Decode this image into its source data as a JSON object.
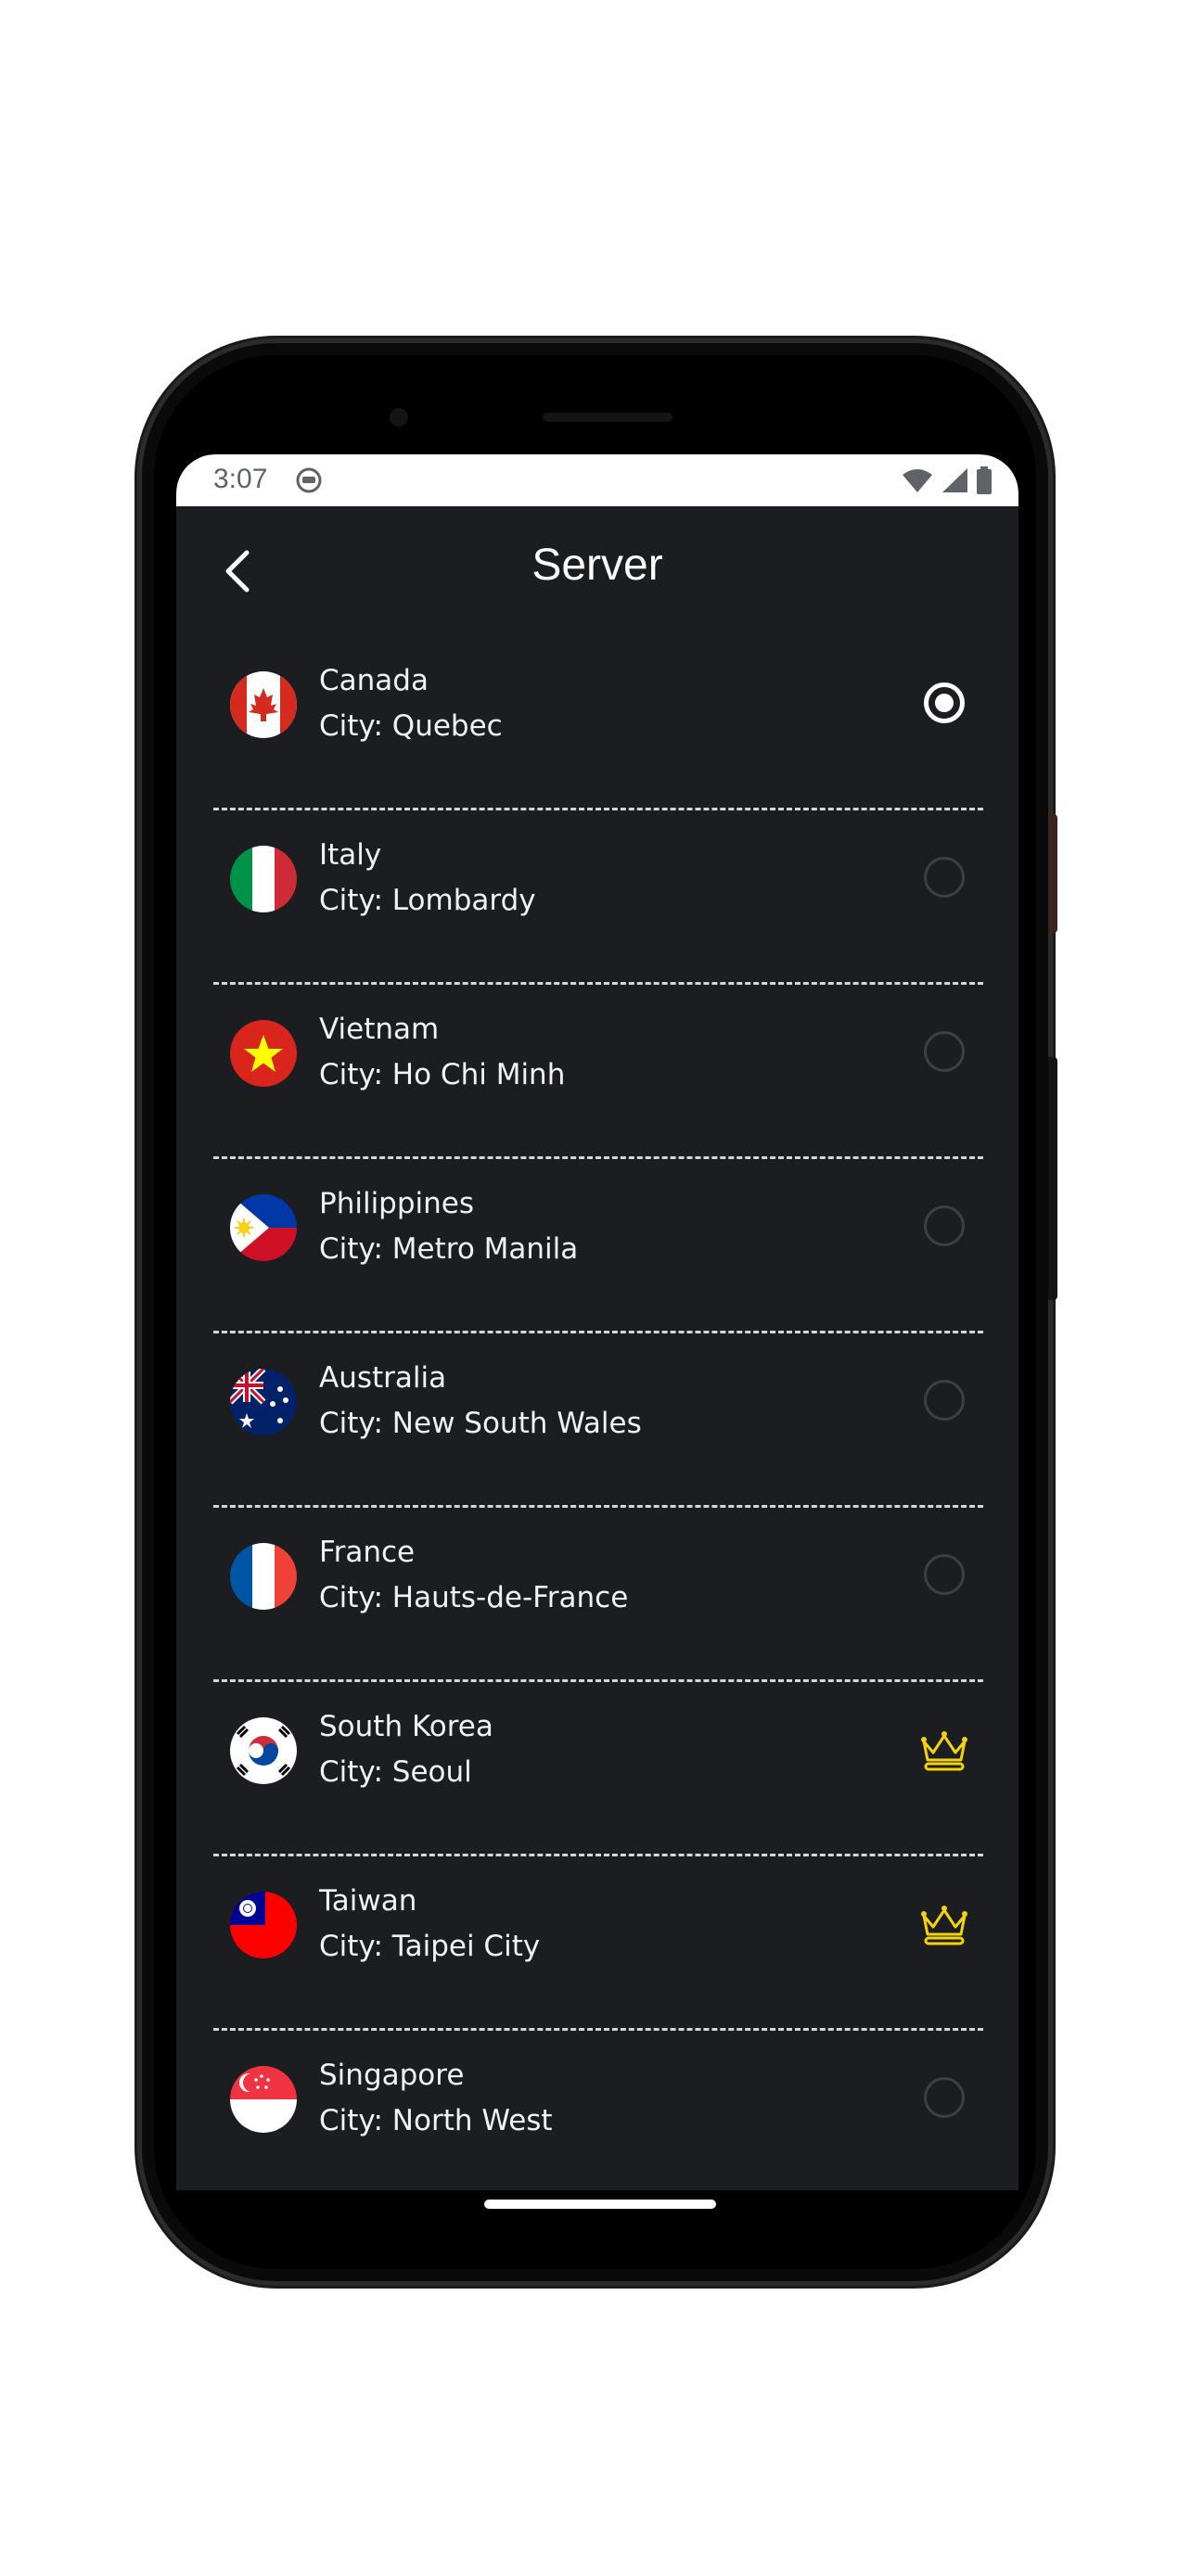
{
  "status_bar": {
    "time": "3:07"
  },
  "header": {
    "title": "Server"
  },
  "colors": {
    "background": "#1c1d21",
    "accent_premium": "#f4d30b",
    "divider": "#d6d6d6"
  },
  "servers": [
    {
      "country": "Canada",
      "city": "City: Quebec",
      "flag": "canada-flag",
      "state": "selected"
    },
    {
      "country": "Italy",
      "city": "City: Lombardy",
      "flag": "italy-flag",
      "state": "unselected"
    },
    {
      "country": "Vietnam",
      "city": "City: Ho Chi Minh",
      "flag": "vietnam-flag",
      "state": "unselected"
    },
    {
      "country": "Philippines",
      "city": "City: Metro Manila",
      "flag": "philippines-flag",
      "state": "unselected"
    },
    {
      "country": "Australia",
      "city": "City: New South Wales",
      "flag": "australia-flag",
      "state": "unselected"
    },
    {
      "country": "France",
      "city": "City: Hauts-de-France",
      "flag": "france-flag",
      "state": "unselected"
    },
    {
      "country": "South Korea",
      "city": "City: Seoul",
      "flag": "south-korea-flag",
      "state": "premium"
    },
    {
      "country": "Taiwan",
      "city": "City: Taipei City",
      "flag": "taiwan-flag",
      "state": "premium"
    },
    {
      "country": "Singapore",
      "city": "City: North West",
      "flag": "singapore-flag",
      "state": "unselected"
    }
  ]
}
